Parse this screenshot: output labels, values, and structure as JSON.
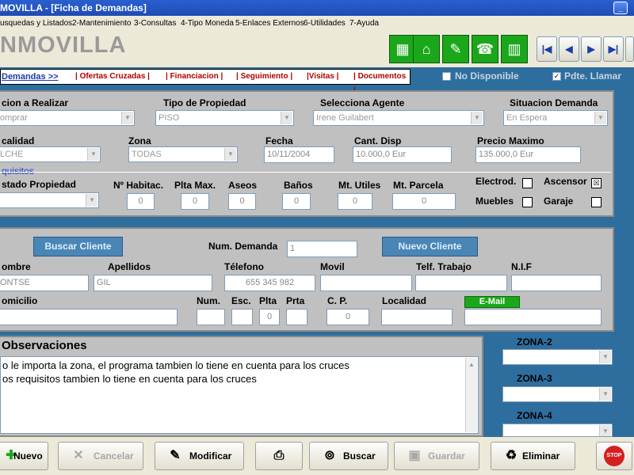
{
  "window": {
    "title": "MOVILLA - [Ficha de Demandas]"
  },
  "menu": [
    "usquedas y Listados",
    "2-Mantenimiento",
    "3-Consultas",
    "4-Tipo Moneda",
    "5-Enlaces Externos",
    "6-Utilidades",
    "7-Ayuda"
  ],
  "header": {
    "logo": "NMOVILLA"
  },
  "tabs": [
    "Demandas >>",
    "| Ofertas Cruzadas |",
    "| Financiacion |",
    "| Seguimiento |",
    "|Visitas |",
    "| Documentos |"
  ],
  "flags": {
    "no_disponible": "No Disponible",
    "pdte_llamar": "Pdte. Llamar",
    "pdte_llamar_checked": "✓"
  },
  "demand": {
    "accion_label": "cion a Realizar",
    "accion_value": "omprar",
    "tipo_label": "Tipo de Propiedad",
    "tipo_value": "PISO",
    "agente_label": "Selecciona Agente",
    "agente_value": "Irene Guilabert",
    "situacion_label": "Situacion Demanda",
    "situacion_value": "En Espera",
    "localidad_label": "calidad",
    "localidad_value": "LCHE",
    "zona_label": "Zona",
    "zona_value": "TODAS",
    "fecha_label": "Fecha",
    "fecha_value": "10/11/2004",
    "cant_label": "Cant. Disp",
    "cant_value": "10.000,0 Eur",
    "precio_label": "Precio Maximo",
    "precio_value": "135.000,0 Eur",
    "requisitos_label": "quisitos",
    "estado_label": "stado Propiedad",
    "habitac_label": "Nº Habitac.",
    "habitac_value": "0",
    "plta_label": "Plta Max.",
    "plta_value": "0",
    "aseos_label": "Aseos",
    "aseos_value": "0",
    "banos_label": "Baños",
    "banos_value": "0",
    "utiles_label": "Mt. Utiles",
    "utiles_value": "0",
    "parcela_label": "Mt. Parcela",
    "parcela_value": "0",
    "electrod_label": "Electrod.",
    "ascensor_label": "Ascensor",
    "ascensor_checked": "☒",
    "muebles_label": "Muebles",
    "garaje_label": "Garaje"
  },
  "client": {
    "buscar_btn": "Buscar Cliente",
    "num_label": "Num. Demanda",
    "num_value": "1",
    "nuevo_btn": "Nuevo Cliente",
    "nombre_label": "ombre",
    "nombre_value": "ONTSE",
    "apellidos_label": "Apellidos",
    "apellidos_value": "GIL",
    "telefono_label": "Télefono",
    "telefono_value": "655 345 982",
    "movil_label": "Movil",
    "trabajo_label": "Telf. Trabajo",
    "nif_label": "N.I.F",
    "domicilio_label": "omicilio",
    "num2_label": "Num.",
    "esc_label": "Esc.",
    "plta2_label": "Plta",
    "plta2_value": "0",
    "prta_label": "Prta",
    "cp_label": "C. P.",
    "cp_value": "0",
    "localidad2_label": "Localidad",
    "email_label": "E-Mail"
  },
  "observaciones": {
    "title": "Observaciones",
    "lines": [
      "o le importa la zona, el programa tambien lo tiene en cuenta para los cruces",
      "os requisitos tambien lo tiene en cuenta para los cruces"
    ]
  },
  "zonas": {
    "zona2": "ZONA-2",
    "zona3": "ZONA-3",
    "zona4": "ZONA-4"
  },
  "toolbar": {
    "nuevo": "Nuevo",
    "cancelar": "Cancelar",
    "modificar": "Modificar",
    "buscar": "Buscar",
    "guardar": "Guardar",
    "eliminar": "Eliminar",
    "stop": "STOP"
  },
  "colors": {
    "accent": "#1aa81a",
    "background": "#2e6e9e",
    "panel": "#c0c0c0"
  }
}
